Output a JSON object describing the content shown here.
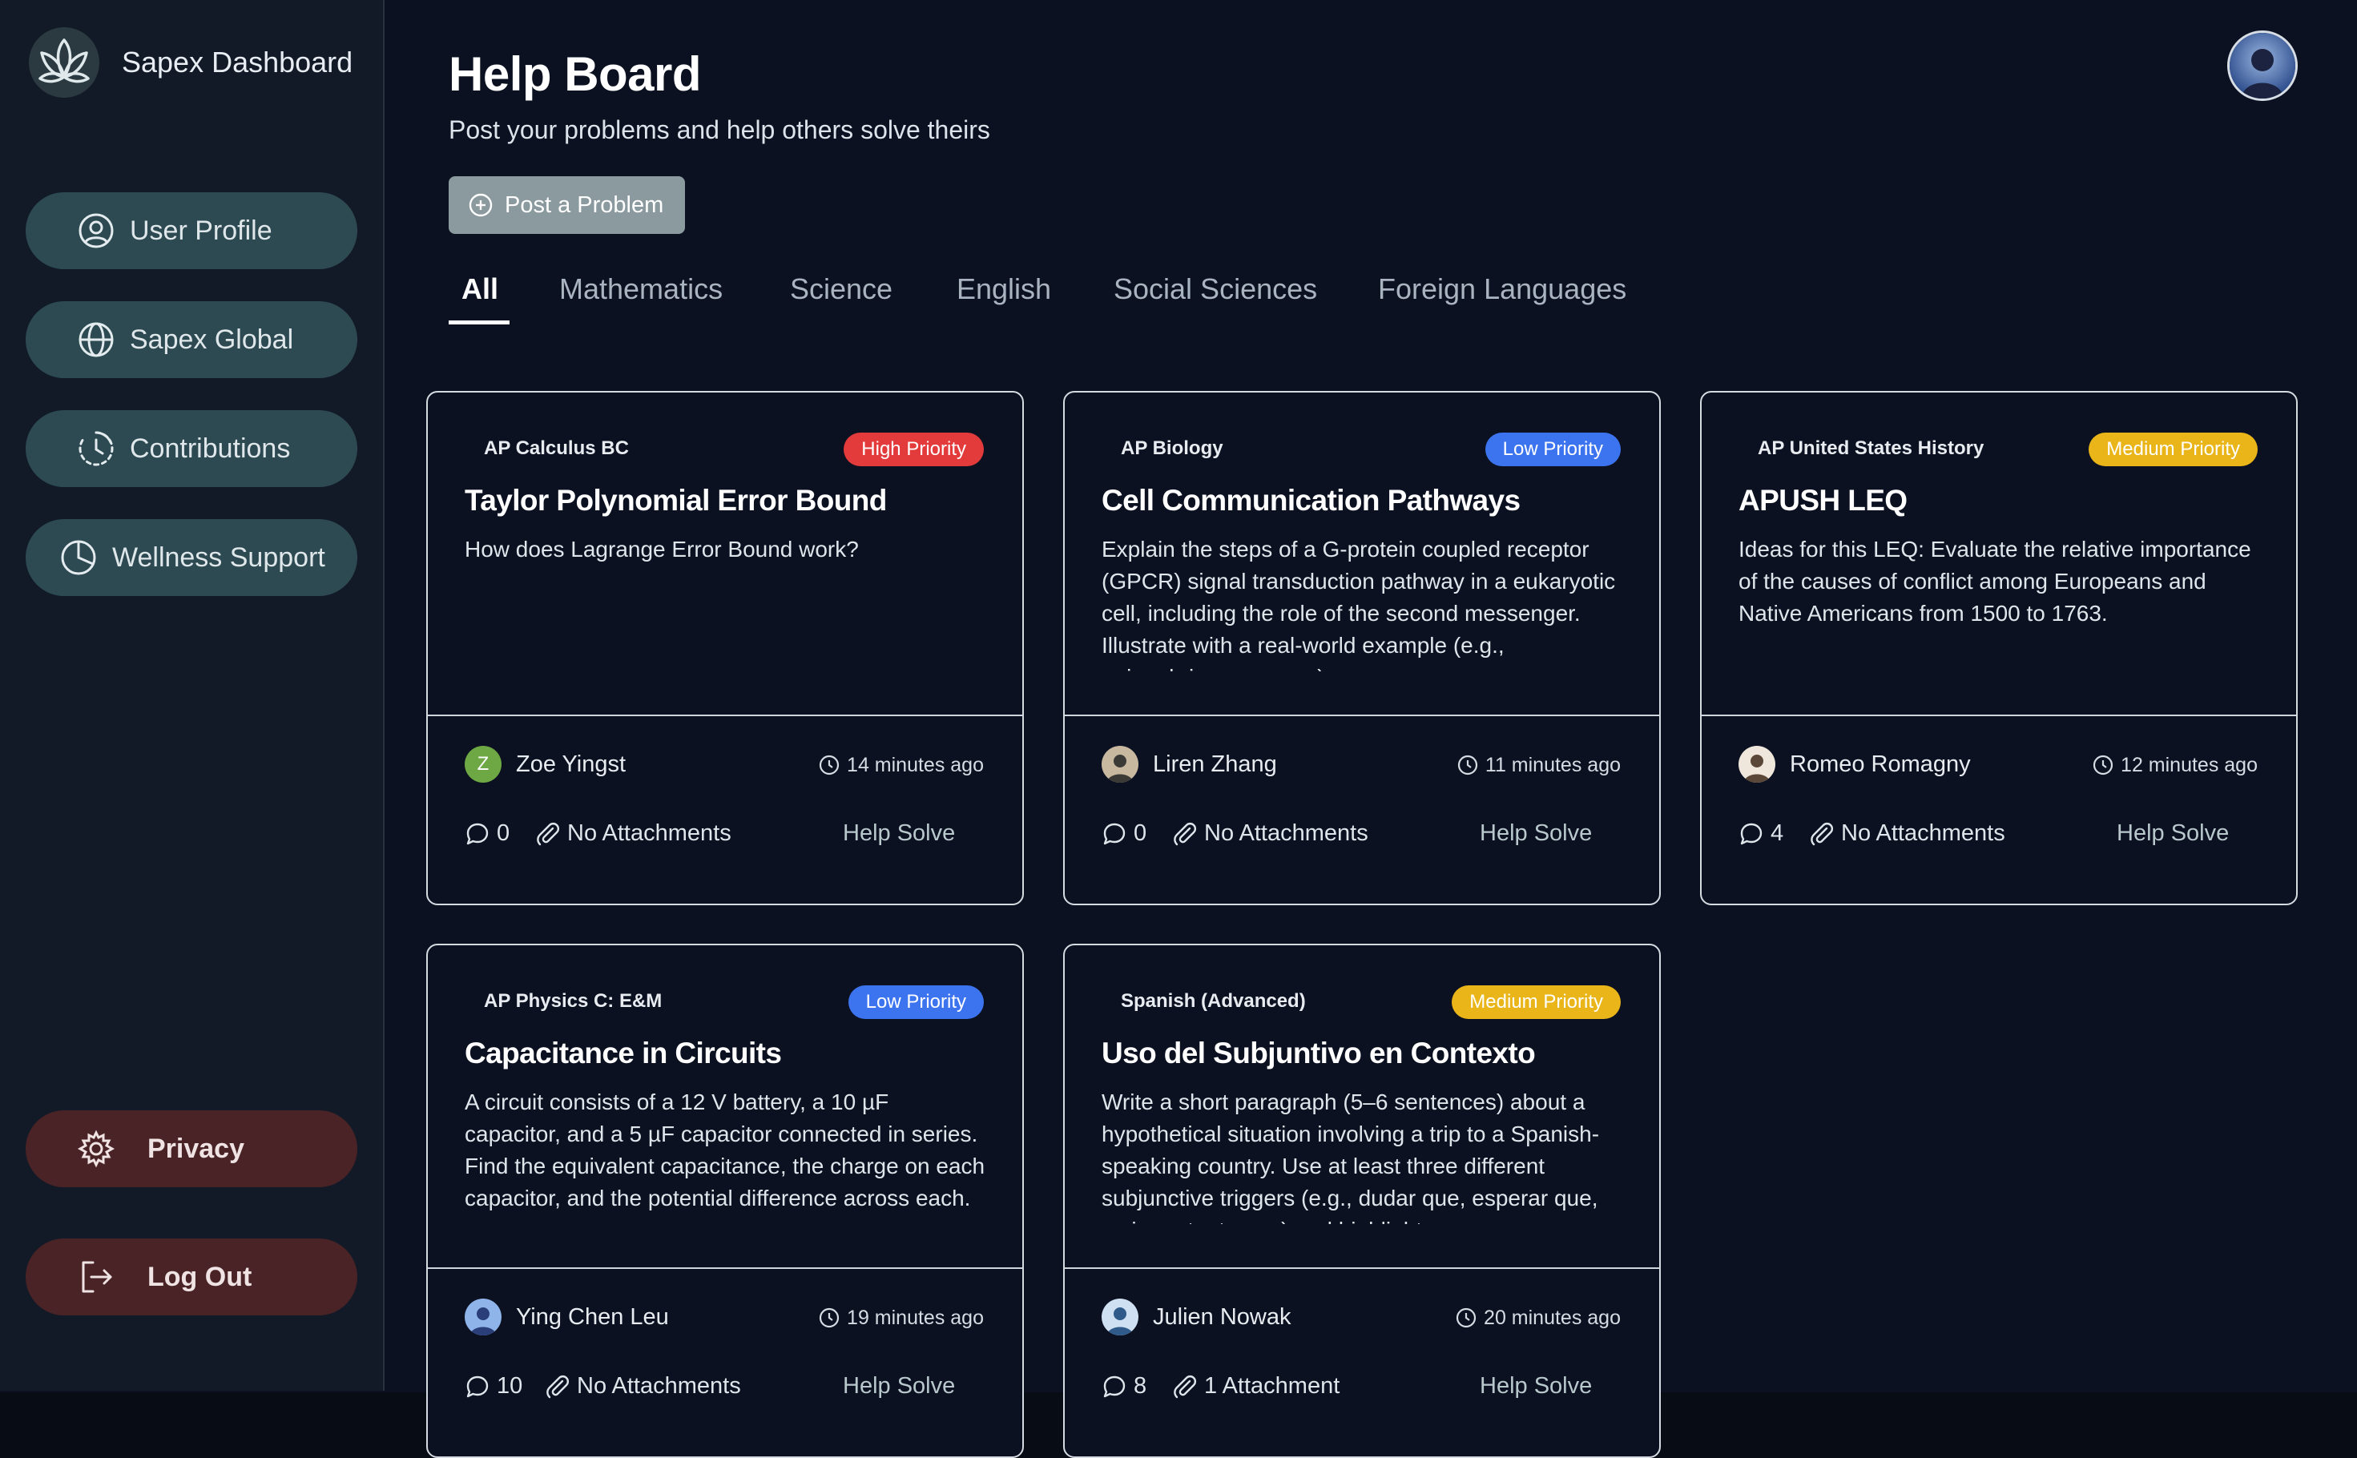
{
  "colors": {
    "background": "#0b1120",
    "sidebar": "#131a27",
    "nav_teal": "#2d4a52",
    "nav_danger": "#4a2326",
    "high": "#e33b3b",
    "low": "#3c74f0",
    "medium": "#e9b519"
  },
  "sidebar": {
    "brand": "Sapex Dashboard",
    "logo_icon": "leaf-logo",
    "items": [
      {
        "label": "User Profile",
        "icon": "user-circle-icon"
      },
      {
        "label": "Sapex Global",
        "icon": "globe-icon"
      },
      {
        "label": "Contributions",
        "icon": "history-icon"
      },
      {
        "label": "Wellness Support",
        "icon": "pie-chart-icon"
      }
    ],
    "privacy": {
      "label": "Privacy",
      "icon": "gear-icon"
    },
    "logout": {
      "label": "Log Out",
      "icon": "logout-icon"
    }
  },
  "header": {
    "title": "Help Board",
    "subtitle": "Post your problems and help others solve theirs",
    "post_button": "Post a Problem"
  },
  "tabs": [
    "All",
    "Mathematics",
    "Science",
    "English",
    "Social Sciences",
    "Foreign Languages"
  ],
  "active_tab": "All",
  "cards": [
    {
      "course": "AP Calculus BC",
      "priority": "High Priority",
      "priority_level": "high",
      "title": "Taylor Polynomial Error Bound",
      "body": "How does Lagrange Error Bound work?",
      "author": "Zoe Yingst",
      "author_initial": "Z",
      "time": "14 minutes ago",
      "comments": "0",
      "attachments": "No Attachments",
      "action": "Help Solve"
    },
    {
      "course": "AP Biology",
      "priority": "Low Priority",
      "priority_level": "low",
      "title": "Cell Communication Pathways",
      "body": "Explain the steps of a G-protein coupled receptor (GPCR) signal transduction pathway in a eukaryotic cell, including the role of the second messenger. Illustrate with a real-world example (e.g., epinephrine response).",
      "author": "Liren Zhang",
      "time": "11 minutes ago",
      "comments": "0",
      "attachments": "No Attachments",
      "action": "Help Solve"
    },
    {
      "course": "AP United States History",
      "priority": "Medium Priority",
      "priority_level": "medium",
      "title": "APUSH LEQ",
      "body": "Ideas for this LEQ: Evaluate the relative importance of the causes of conflict among Europeans and Native Americans from 1500 to 1763.",
      "author": "Romeo Romagny",
      "time": "12 minutes ago",
      "comments": "4",
      "attachments": "No Attachments",
      "action": "Help Solve"
    },
    {
      "course": "AP Physics C: E&M",
      "priority": "Low Priority",
      "priority_level": "low",
      "title": "Capacitance in Circuits",
      "body": "A circuit consists of a 12 V battery, a 10 µF capacitor, and a 5 µF capacitor connected in series. Find the equivalent capacitance, the charge on each capacitor, and the potential difference across each.",
      "author": "Ying Chen Leu",
      "time": "19 minutes ago",
      "comments": "10",
      "attachments": "No Attachments",
      "action": "Help Solve"
    },
    {
      "course": "Spanish (Advanced)",
      "priority": "Medium Priority",
      "priority_level": "medium",
      "title": "Uso del Subjuntivo en Contexto",
      "body": "Write a short paragraph (5–6 sentences) about a hypothetical situation involving a trip to a Spanish-speaking country. Use at least three different subjunctive triggers (e.g., dudar que, esperar que, es importante que) and highlight",
      "author": "Julien Nowak",
      "time": "20 minutes ago",
      "comments": "8",
      "attachments": "1 Attachment",
      "action": "Help Solve"
    }
  ]
}
